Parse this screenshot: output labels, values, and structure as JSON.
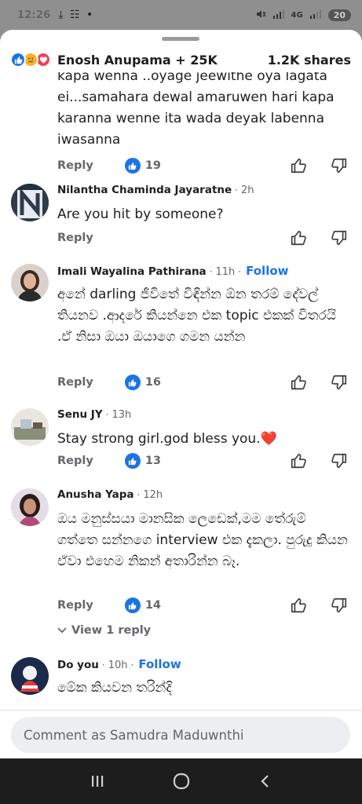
{
  "status_bar": {
    "time": "12:26",
    "left_icons": "⤓ ☷ •",
    "signal_label": "4G",
    "battery": "20"
  },
  "header": {
    "reacted_by": "Enosh Anupama + 25K",
    "shares": "1.2K shares"
  },
  "comments": [
    {
      "author": "",
      "time": "",
      "follow": "",
      "text": "kapa wenna ..oyage jeewithe oya lagata ei...samahara dewal amaruwen hari kapa karanna wenne ita wada deyak labenna iwasanna",
      "reply_label": "Reply",
      "likes": "19"
    },
    {
      "author": "Nilantha Chaminda Jayaratne",
      "time": "2h",
      "follow": "",
      "text": "Are you hit by someone?",
      "reply_label": "Reply",
      "likes": ""
    },
    {
      "author": "Imali Wayalina Pathirana",
      "time": "11h",
      "follow": "Follow",
      "text": "අනේ darling ජීවිතේ විඳින්න ඕන තරම් දේවල් තියනව .ආදරේ කියන්නෙ එක topic එකක් විතරයි .ඒ නිසා ඔයා ඔයාගෙ ගමන යන්න",
      "reply_label": "Reply",
      "likes": "16"
    },
    {
      "author": "Senu JY",
      "time": "13h",
      "follow": "",
      "text": "Stay strong girl.god bless you.❤️",
      "reply_label": "Reply",
      "likes": "13"
    },
    {
      "author": "Anusha Yapa",
      "time": "12h",
      "follow": "",
      "text": "ඔය මනුස්සයා මානසික ලෙඩෙක්,මම තේරුම් ගත්තෙ සන්නගෙ interview එක දැකලා. පුරුදු කියන ඒවා එහෙම නිකන් අතාරින්න බෑ.",
      "reply_label": "Reply",
      "likes": "14",
      "view_replies": "View 1 reply"
    },
    {
      "author": "Do you",
      "time": "10h",
      "follow": "Follow",
      "text": "මේක කියවන තරින්දි",
      "reply_label": "",
      "likes": ""
    }
  ],
  "composer": {
    "placeholder": "Comment as Samudra Maduwnthi"
  },
  "colors": {
    "accent": "#1b74e4",
    "like": "#1b74e4",
    "sad": "#f7b125",
    "love": "#f33e58",
    "heart": "#e0263e"
  },
  "icons": {
    "like_reaction": "like-icon",
    "sad_reaction": "sad-icon",
    "love_reaction": "love-icon",
    "thumb_up": "thumb-up-icon",
    "thumb_down": "thumb-down-icon",
    "nav": [
      "recents-icon",
      "home-icon",
      "back-icon"
    ]
  }
}
